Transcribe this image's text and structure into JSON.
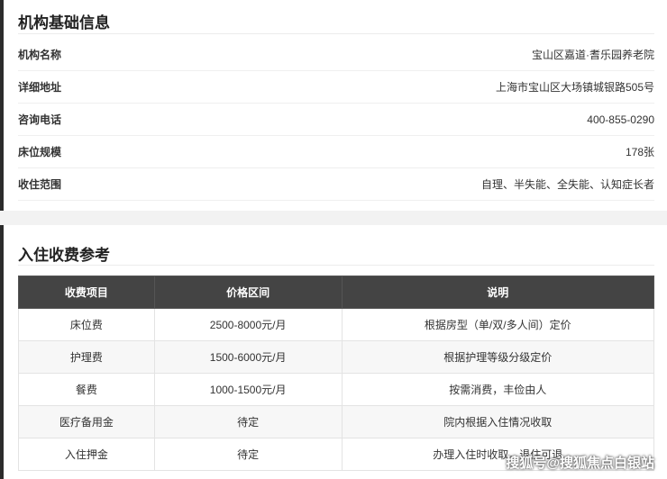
{
  "basic_info": {
    "title": "机构基础信息",
    "rows": [
      {
        "label": "机构名称",
        "value": "宝山区嘉道·耆乐园养老院"
      },
      {
        "label": "详细地址",
        "value": "上海市宝山区大场镇城银路505号"
      },
      {
        "label": "咨询电话",
        "value": "400-855-0290"
      },
      {
        "label": "床位规模",
        "value": "178张"
      },
      {
        "label": "收住范围",
        "value": "自理、半失能、全失能、认知症长者"
      }
    ]
  },
  "fees": {
    "title": "入住收费参考",
    "headers": [
      "收费项目",
      "价格区间",
      "说明"
    ],
    "rows": [
      [
        "床位费",
        "2500-8000元/月",
        "根据房型（单/双/多人间）定价"
      ],
      [
        "护理费",
        "1500-6000元/月",
        "根据护理等级分级定价"
      ],
      [
        "餐费",
        "1000-1500元/月",
        "按需消费，丰俭由人"
      ],
      [
        "医疗备用金",
        "待定",
        "院内根据入住情况收取"
      ],
      [
        "入住押金",
        "待定",
        "办理入住时收取，退住可退"
      ]
    ]
  },
  "watermark": "搜狐号@搜狐焦点白银站"
}
